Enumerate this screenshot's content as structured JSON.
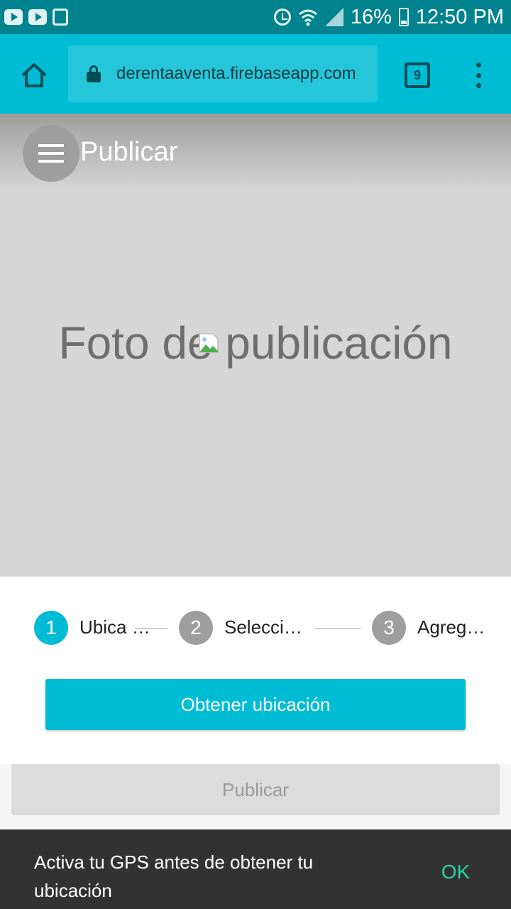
{
  "status_bar": {
    "battery": "16%",
    "time": "12:50 PM"
  },
  "browser": {
    "url": "derentaaventa.firebaseapp.com",
    "tab_count": "9",
    "icons": [
      "home-icon",
      "lock-icon",
      "tabs-icon",
      "more-vert-icon"
    ]
  },
  "header": {
    "title": "Publicar"
  },
  "hero": {
    "placeholder_text": "Foto de publicación"
  },
  "stepper": {
    "steps": [
      {
        "number": "1",
        "label": "Ubica …",
        "state": "active"
      },
      {
        "number": "2",
        "label": "Selecci…",
        "state": "inactive"
      },
      {
        "number": "3",
        "label": "Agreg…",
        "state": "inactive"
      }
    ]
  },
  "actions": {
    "get_location_label": "Obtener ubicación",
    "publish_label": "Publicar"
  },
  "snackbar": {
    "message": "Activa tu GPS antes de obtener tu ubicación",
    "action": "OK"
  },
  "colors": {
    "accent": "#00bcd4",
    "status_bar": "#00838f",
    "inactive_step": "#9e9e9e",
    "snackbar_action": "#2ed3a0"
  }
}
